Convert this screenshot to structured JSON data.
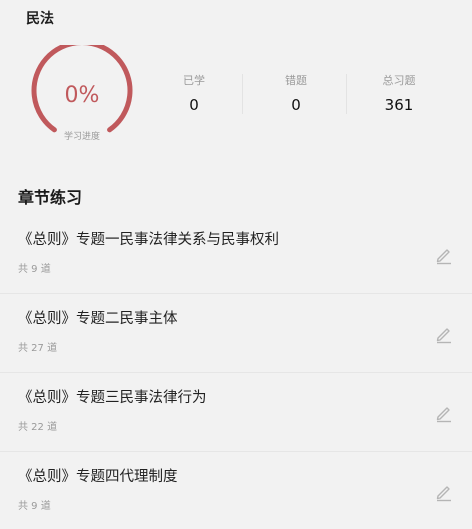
{
  "header": {
    "title": "民法"
  },
  "progress": {
    "percent_text": "0%",
    "fraction": 0,
    "caption": "学习进度",
    "accent_color": "#c0595c"
  },
  "stats": [
    {
      "label": "已学",
      "value": "0"
    },
    {
      "label": "错题",
      "value": "0"
    },
    {
      "label": "总习题",
      "value": "361"
    }
  ],
  "section": {
    "title": "章节练习"
  },
  "chapters": [
    {
      "title": "《总则》专题一民事法律关系与民事权利",
      "count": "共 9 道",
      "icon": "edit-icon"
    },
    {
      "title": "《总则》专题二民事主体",
      "count": "共 27 道",
      "icon": "edit-icon"
    },
    {
      "title": "《总则》专题三民事法律行为",
      "count": "共 22 道",
      "icon": "edit-icon"
    },
    {
      "title": "《总则》专题四代理制度",
      "count": "共 9 道",
      "icon": "edit-icon"
    }
  ]
}
